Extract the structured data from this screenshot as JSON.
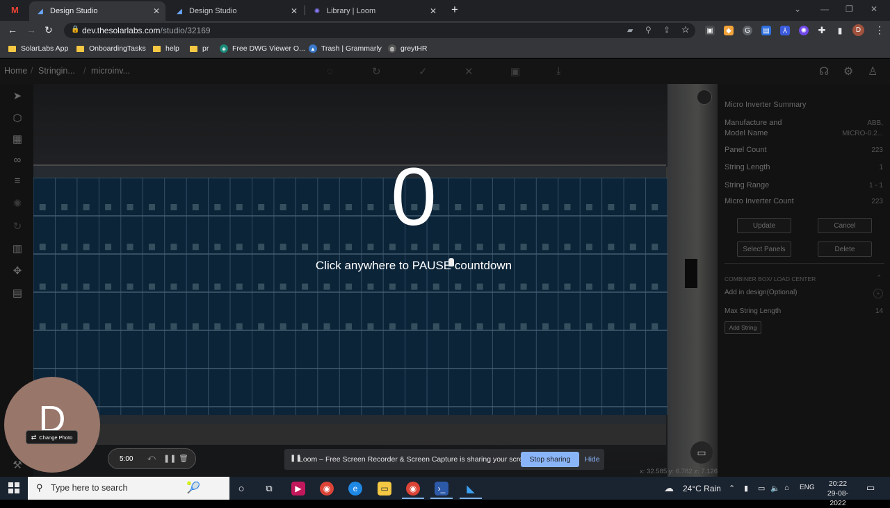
{
  "browser": {
    "tabs": [
      {
        "label": "Design Studio",
        "active": true
      },
      {
        "label": "Design Studio",
        "active": false
      },
      {
        "label": "Library | Loom",
        "active": false
      }
    ],
    "url_host": "dev.thesolarlabs.com",
    "url_path": "/studio/32169",
    "profile_initial": "D",
    "bookmarks": [
      "SolarLabs App",
      "OnboardingTasks",
      "help",
      "pr",
      "Free DWG Viewer O...",
      "Trash | Grammarly",
      "greytHR"
    ]
  },
  "app": {
    "breadcrumbs": [
      "Home",
      "Stringin...",
      "microinv..."
    ],
    "countdown": {
      "number": "0",
      "hint": "Click anywhere to PAUSE countdown"
    },
    "summary": {
      "title": "Micro Inverter Summary",
      "manufacturer_label": "Manufacture and Model Name",
      "manufacturer_value_1": "ABB,",
      "manufacturer_value_2": "MICRO-0.2...",
      "panel_count_label": "Panel Count",
      "panel_count_value": "223",
      "string_length_label": "String Length",
      "string_length_value": "1",
      "string_range_label": "String Range",
      "string_range_value": "1 - 1",
      "micro_inverter_count_label": "Micro Inverter Count",
      "micro_inverter_count_value": "223",
      "update_label": "Update",
      "cancel_label": "Cancel",
      "select_panels_label": "Select Panels",
      "delete_label": "Delete",
      "combiner_label": "COMBINER BOX/ LOAD CENTER",
      "add_in_design_label": "Add in design(Optional)",
      "max_string_length_label": "Max String Length",
      "max_string_length_value": "14",
      "add_string_label": "Add String"
    },
    "coords": "x: 32.585 y: 6.782 z: 7.126"
  },
  "loom": {
    "avatar_letter": "D",
    "change_photo": "Change Photo",
    "timer": "5:00",
    "share_message": "Loom – Free Screen Recorder & Screen Capture is sharing your screen.",
    "stop_sharing": "Stop sharing",
    "hide": "Hide"
  },
  "taskbar": {
    "search_placeholder": "Type here to search",
    "weather": "24°C Rain",
    "language": "ENG",
    "time": "20:22",
    "date": "29-08-2022"
  },
  "colors": {
    "panel_blue": "#0e2940",
    "loom_avatar": "#98766a",
    "stop_button": "#8ab4f8"
  }
}
